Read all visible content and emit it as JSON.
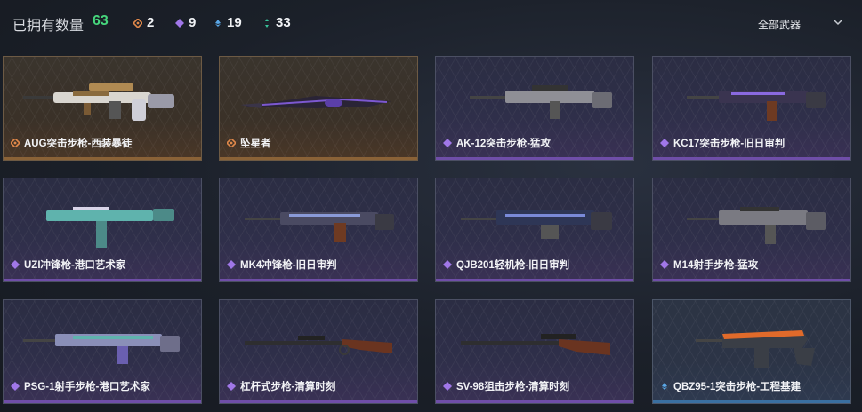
{
  "header": {
    "owned_label": "已拥有数量",
    "owned_count": "63",
    "stats": [
      {
        "icon": "legendary-icon",
        "value": "2",
        "color": "#e0884a"
      },
      {
        "icon": "epic-icon",
        "value": "9",
        "color": "#a077e8"
      },
      {
        "icon": "rare-icon",
        "value": "19",
        "color": "#5aa7e6"
      },
      {
        "icon": "uncommon-icon",
        "value": "33",
        "color": "#39c39a"
      }
    ],
    "filter_label": "全部武器"
  },
  "cards": [
    {
      "name": "AUG突击步枪-西装暴徒",
      "rarity": "legendary"
    },
    {
      "name": "坠星者",
      "rarity": "legendary"
    },
    {
      "name": "AK-12突击步枪-猛攻",
      "rarity": "epic"
    },
    {
      "name": "KC17突击步枪-旧日审判",
      "rarity": "epic"
    },
    {
      "name": "UZI冲锋枪-港口艺术家",
      "rarity": "epic"
    },
    {
      "name": "MK4冲锋枪-旧日审判",
      "rarity": "epic"
    },
    {
      "name": "QJB201轻机枪-旧日审判",
      "rarity": "epic"
    },
    {
      "name": "M14射手步枪-猛攻",
      "rarity": "epic"
    },
    {
      "name": "PSG-1射手步枪-港口艺术家",
      "rarity": "epic"
    },
    {
      "name": "杠杆式步枪-清算时刻",
      "rarity": "epic"
    },
    {
      "name": "SV-98狙击步枪-清算时刻",
      "rarity": "epic"
    },
    {
      "name": "QBZ95-1突击步枪-工程基建",
      "rarity": "rare"
    }
  ],
  "colors": {
    "legendary": "#e0884a",
    "epic": "#a077e8",
    "rare": "#5aa7e6",
    "uncommon": "#39c39a",
    "accent_count": "#46d67c"
  }
}
